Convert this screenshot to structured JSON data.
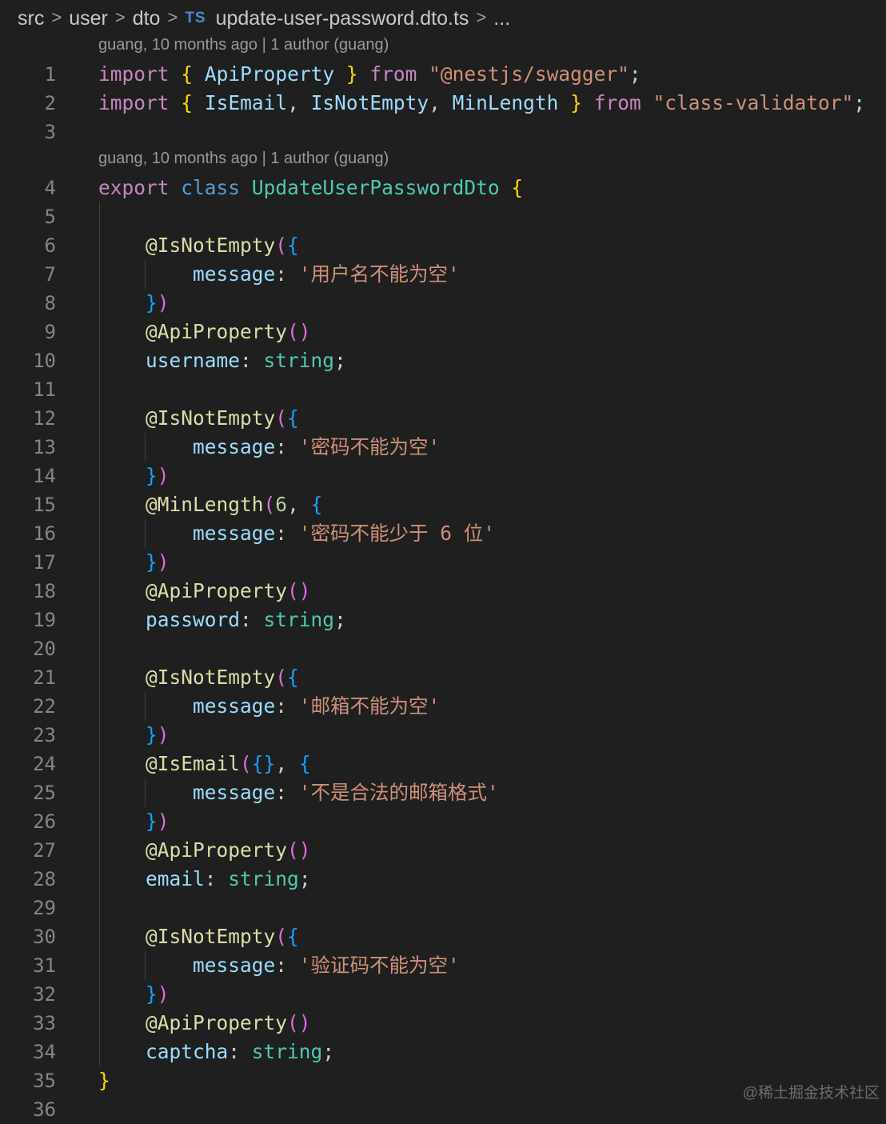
{
  "breadcrumb": {
    "items": [
      "src",
      "user",
      "dto"
    ],
    "ts_badge": "TS",
    "file": "update-user-password.dto.ts",
    "ellipsis": "...",
    "separator": ">"
  },
  "codelens": [
    {
      "before_line": 1,
      "text": "guang, 10 months ago | 1 author (guang)"
    },
    {
      "before_line": 4,
      "text": "guang, 10 months ago | 1 author (guang)"
    }
  ],
  "lines": [
    {
      "n": "1",
      "tokens": [
        [
          "kw",
          "import"
        ],
        [
          "pun",
          " "
        ],
        [
          "br1",
          "{"
        ],
        [
          "pun",
          " "
        ],
        [
          "var",
          "ApiProperty"
        ],
        [
          "pun",
          " "
        ],
        [
          "br1",
          "}"
        ],
        [
          "pun",
          " "
        ],
        [
          "kw",
          "from"
        ],
        [
          "pun",
          " "
        ],
        [
          "str",
          "\"@nestjs/swagger\""
        ],
        [
          "pun",
          ";"
        ]
      ]
    },
    {
      "n": "2",
      "tokens": [
        [
          "kw",
          "import"
        ],
        [
          "pun",
          " "
        ],
        [
          "br1",
          "{"
        ],
        [
          "pun",
          " "
        ],
        [
          "var",
          "IsEmail"
        ],
        [
          "pun",
          ", "
        ],
        [
          "var",
          "IsNotEmpty"
        ],
        [
          "pun",
          ", "
        ],
        [
          "var",
          "MinLength"
        ],
        [
          "pun",
          " "
        ],
        [
          "br1",
          "}"
        ],
        [
          "pun",
          " "
        ],
        [
          "kw",
          "from"
        ],
        [
          "pun",
          " "
        ],
        [
          "str",
          "\"class-validator\""
        ],
        [
          "pun",
          ";"
        ]
      ]
    },
    {
      "n": "3",
      "tokens": []
    },
    {
      "n": "4",
      "tokens": [
        [
          "kw",
          "export"
        ],
        [
          "pun",
          " "
        ],
        [
          "st",
          "class"
        ],
        [
          "pun",
          " "
        ],
        [
          "cls",
          "UpdateUserPasswordDto"
        ],
        [
          "pun",
          " "
        ],
        [
          "br1",
          "{"
        ]
      ]
    },
    {
      "n": "5",
      "tokens": []
    },
    {
      "n": "6",
      "tokens": [
        [
          "pun",
          "    "
        ],
        [
          "fn",
          "@IsNotEmpty"
        ],
        [
          "br2",
          "("
        ],
        [
          "br3",
          "{"
        ]
      ]
    },
    {
      "n": "7",
      "tokens": [
        [
          "pun",
          "        "
        ],
        [
          "var",
          "message"
        ],
        [
          "pun",
          ": "
        ],
        [
          "str",
          "'用户名不能为空'"
        ]
      ]
    },
    {
      "n": "8",
      "tokens": [
        [
          "pun",
          "    "
        ],
        [
          "br3",
          "}"
        ],
        [
          "br2",
          ")"
        ]
      ]
    },
    {
      "n": "9",
      "tokens": [
        [
          "pun",
          "    "
        ],
        [
          "fn",
          "@ApiProperty"
        ],
        [
          "br2",
          "()"
        ]
      ]
    },
    {
      "n": "10",
      "tokens": [
        [
          "pun",
          "    "
        ],
        [
          "var",
          "username"
        ],
        [
          "pun",
          ": "
        ],
        [
          "cls",
          "string"
        ],
        [
          "pun",
          ";"
        ]
      ]
    },
    {
      "n": "11",
      "tokens": []
    },
    {
      "n": "12",
      "tokens": [
        [
          "pun",
          "    "
        ],
        [
          "fn",
          "@IsNotEmpty"
        ],
        [
          "br2",
          "("
        ],
        [
          "br3",
          "{"
        ]
      ]
    },
    {
      "n": "13",
      "tokens": [
        [
          "pun",
          "        "
        ],
        [
          "var",
          "message"
        ],
        [
          "pun",
          ": "
        ],
        [
          "str",
          "'密码不能为空'"
        ]
      ]
    },
    {
      "n": "14",
      "tokens": [
        [
          "pun",
          "    "
        ],
        [
          "br3",
          "}"
        ],
        [
          "br2",
          ")"
        ]
      ]
    },
    {
      "n": "15",
      "tokens": [
        [
          "pun",
          "    "
        ],
        [
          "fn",
          "@MinLength"
        ],
        [
          "br2",
          "("
        ],
        [
          "num",
          "6"
        ],
        [
          "pun",
          ", "
        ],
        [
          "br3",
          "{"
        ]
      ]
    },
    {
      "n": "16",
      "tokens": [
        [
          "pun",
          "        "
        ],
        [
          "var",
          "message"
        ],
        [
          "pun",
          ": "
        ],
        [
          "str",
          "'密码不能少于 6 位'"
        ]
      ]
    },
    {
      "n": "17",
      "tokens": [
        [
          "pun",
          "    "
        ],
        [
          "br3",
          "}"
        ],
        [
          "br2",
          ")"
        ]
      ]
    },
    {
      "n": "18",
      "tokens": [
        [
          "pun",
          "    "
        ],
        [
          "fn",
          "@ApiProperty"
        ],
        [
          "br2",
          "()"
        ]
      ]
    },
    {
      "n": "19",
      "tokens": [
        [
          "pun",
          "    "
        ],
        [
          "var",
          "password"
        ],
        [
          "pun",
          ": "
        ],
        [
          "cls",
          "string"
        ],
        [
          "pun",
          ";"
        ]
      ]
    },
    {
      "n": "20",
      "tokens": []
    },
    {
      "n": "21",
      "tokens": [
        [
          "pun",
          "    "
        ],
        [
          "fn",
          "@IsNotEmpty"
        ],
        [
          "br2",
          "("
        ],
        [
          "br3",
          "{"
        ]
      ]
    },
    {
      "n": "22",
      "tokens": [
        [
          "pun",
          "        "
        ],
        [
          "var",
          "message"
        ],
        [
          "pun",
          ": "
        ],
        [
          "str",
          "'邮箱不能为空'"
        ]
      ]
    },
    {
      "n": "23",
      "tokens": [
        [
          "pun",
          "    "
        ],
        [
          "br3",
          "}"
        ],
        [
          "br2",
          ")"
        ]
      ]
    },
    {
      "n": "24",
      "tokens": [
        [
          "pun",
          "    "
        ],
        [
          "fn",
          "@IsEmail"
        ],
        [
          "br2",
          "("
        ],
        [
          "br3",
          "{}"
        ],
        [
          "pun",
          ", "
        ],
        [
          "br3",
          "{"
        ]
      ]
    },
    {
      "n": "25",
      "tokens": [
        [
          "pun",
          "        "
        ],
        [
          "var",
          "message"
        ],
        [
          "pun",
          ": "
        ],
        [
          "str",
          "'不是合法的邮箱格式'"
        ]
      ]
    },
    {
      "n": "26",
      "tokens": [
        [
          "pun",
          "    "
        ],
        [
          "br3",
          "}"
        ],
        [
          "br2",
          ")"
        ]
      ]
    },
    {
      "n": "27",
      "tokens": [
        [
          "pun",
          "    "
        ],
        [
          "fn",
          "@ApiProperty"
        ],
        [
          "br2",
          "()"
        ]
      ]
    },
    {
      "n": "28",
      "tokens": [
        [
          "pun",
          "    "
        ],
        [
          "var",
          "email"
        ],
        [
          "pun",
          ": "
        ],
        [
          "cls",
          "string"
        ],
        [
          "pun",
          ";"
        ]
      ]
    },
    {
      "n": "29",
      "tokens": []
    },
    {
      "n": "30",
      "tokens": [
        [
          "pun",
          "    "
        ],
        [
          "fn",
          "@IsNotEmpty"
        ],
        [
          "br2",
          "("
        ],
        [
          "br3",
          "{"
        ]
      ]
    },
    {
      "n": "31",
      "tokens": [
        [
          "pun",
          "        "
        ],
        [
          "var",
          "message"
        ],
        [
          "pun",
          ": "
        ],
        [
          "str",
          "'验证码不能为空'"
        ]
      ]
    },
    {
      "n": "32",
      "tokens": [
        [
          "pun",
          "    "
        ],
        [
          "br3",
          "}"
        ],
        [
          "br2",
          ")"
        ]
      ]
    },
    {
      "n": "33",
      "tokens": [
        [
          "pun",
          "    "
        ],
        [
          "fn",
          "@ApiProperty"
        ],
        [
          "br2",
          "()"
        ]
      ]
    },
    {
      "n": "34",
      "tokens": [
        [
          "pun",
          "    "
        ],
        [
          "var",
          "captcha"
        ],
        [
          "pun",
          ": "
        ],
        [
          "cls",
          "string"
        ],
        [
          "pun",
          ";"
        ]
      ]
    },
    {
      "n": "35",
      "tokens": [
        [
          "br1",
          "}"
        ]
      ]
    },
    {
      "n": "36",
      "tokens": []
    }
  ],
  "watermark": "@稀土掘金技术社区"
}
